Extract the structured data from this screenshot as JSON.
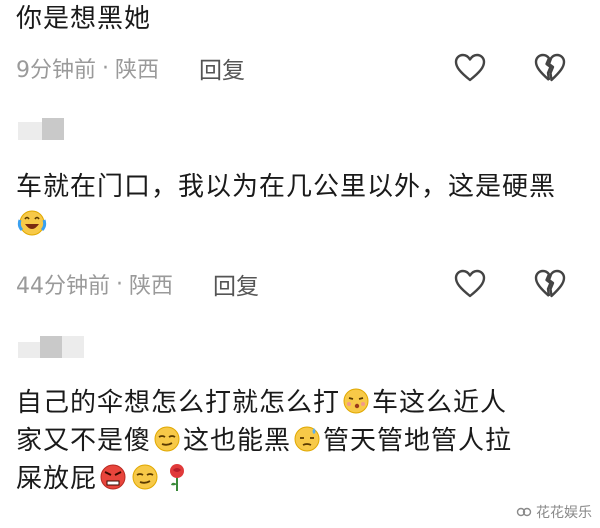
{
  "comments": [
    {
      "text_parts": [
        "你是想黑她"
      ],
      "time": "9分钟前",
      "location": "陕西",
      "reply_label": "回复"
    },
    {
      "text_parts": [
        "车就在门口，我以为在几公里以外，这是硬黑"
      ],
      "time": "44分钟前",
      "location": "陕西",
      "reply_label": "回复"
    },
    {
      "line1a": "自己的伞想怎么打就怎么打",
      "line1b": "车这么近人",
      "line2a": "家又不是傻",
      "line2b": "这也能黑",
      "line2c": "管天管地管人拉",
      "line3a": "屎放屁"
    }
  ],
  "separator": "·",
  "watermark": "花花娱乐",
  "icons": {
    "like": "heart-outline-icon",
    "dislike": "broken-heart-outline-icon",
    "emoji_laugh_cry": "laughing-crying-emoji",
    "emoji_kiss": "kissing-emoji",
    "emoji_smirk": "smirk-emoji",
    "emoji_sweat": "downcast-sweat-emoji",
    "emoji_angry": "angry-emoji",
    "emoji_rose": "rose-emoji"
  }
}
